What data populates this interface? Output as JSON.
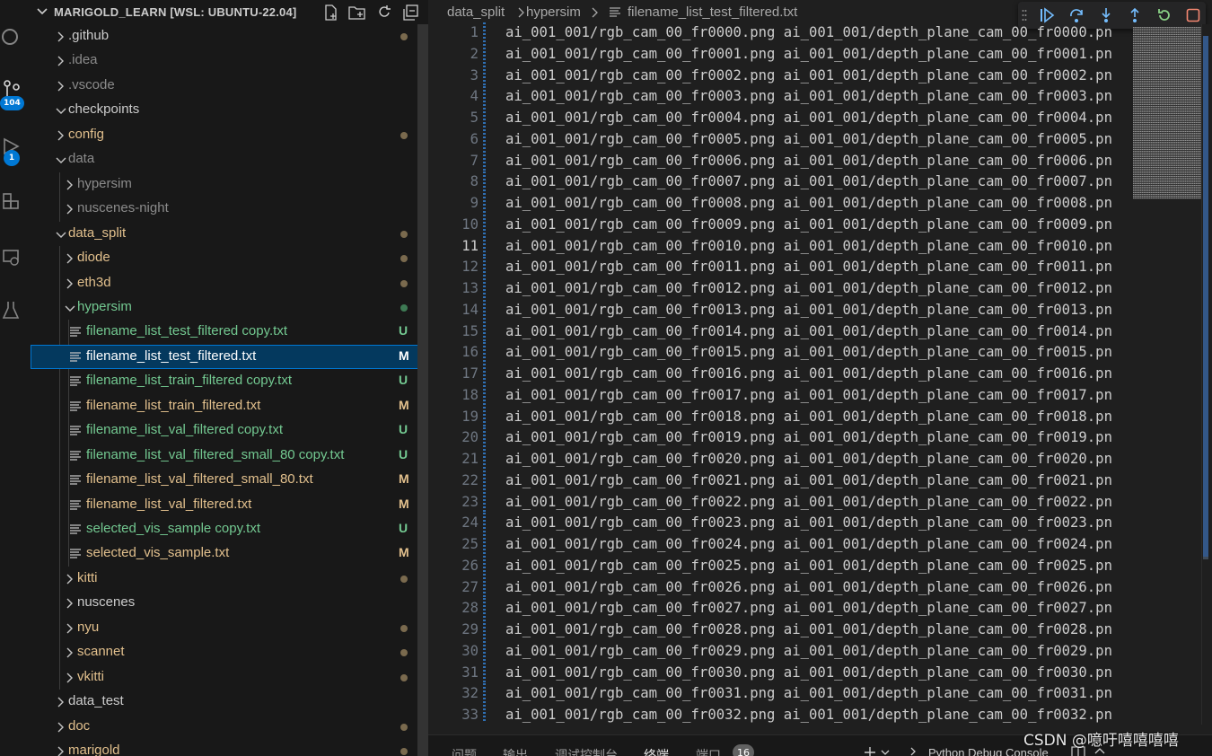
{
  "colors": {
    "folder_text": "#cccccc",
    "dim_text": "#8b8b8b",
    "modified": "#e2c08d",
    "untracked": "#73c991",
    "dot_modified": "#7a6a4e",
    "dot_green": "#3e7a54",
    "accent": "#0078d4"
  },
  "activity_bar": {
    "items": [
      {
        "icon": "search-icon"
      },
      {
        "icon": "source-control-icon",
        "badge": "104"
      },
      {
        "icon": "run-debug-icon",
        "badge": "1"
      },
      {
        "icon": "extensions-icon"
      },
      {
        "icon": "remote-explorer-icon"
      },
      {
        "icon": "testing-icon"
      }
    ]
  },
  "explorer": {
    "title": "MARIGOLD_LEARN [WSL: UBUNTU-22.04]",
    "actions": [
      "new-file-icon",
      "new-folder-icon",
      "refresh-icon",
      "collapse-all-icon"
    ],
    "tree": [
      {
        "label": ".github",
        "depth": 0,
        "type": "folder",
        "expanded": false,
        "color": "folder",
        "decoration": "dot-modified"
      },
      {
        "label": ".idea",
        "depth": 0,
        "type": "folder",
        "expanded": false,
        "color": "dim"
      },
      {
        "label": ".vscode",
        "depth": 0,
        "type": "folder",
        "expanded": false,
        "color": "dim"
      },
      {
        "label": "checkpoints",
        "depth": 0,
        "type": "folder",
        "expanded": true,
        "color": "folder"
      },
      {
        "label": "config",
        "depth": 0,
        "type": "folder",
        "expanded": false,
        "color": "modified",
        "decoration": "dot-modified"
      },
      {
        "label": "data",
        "depth": 0,
        "type": "folder",
        "expanded": true,
        "color": "dim"
      },
      {
        "label": "hypersim",
        "depth": 1,
        "type": "folder",
        "expanded": false,
        "color": "dim"
      },
      {
        "label": "nuscenes-night",
        "depth": 1,
        "type": "folder",
        "expanded": false,
        "color": "dim"
      },
      {
        "label": "data_split",
        "depth": 0,
        "type": "folder",
        "expanded": true,
        "color": "modified",
        "decoration": "dot-modified"
      },
      {
        "label": "diode",
        "depth": 1,
        "type": "folder",
        "expanded": false,
        "color": "modified",
        "decoration": "dot-modified"
      },
      {
        "label": "eth3d",
        "depth": 1,
        "type": "folder",
        "expanded": false,
        "color": "modified",
        "decoration": "dot-modified"
      },
      {
        "label": "hypersim",
        "depth": 1,
        "type": "folder",
        "expanded": true,
        "color": "untracked",
        "decoration": "dot-green"
      },
      {
        "label": "filename_list_test_filtered copy.txt",
        "depth": 2,
        "type": "file",
        "color": "untracked",
        "status": "U"
      },
      {
        "label": "filename_list_test_filtered.txt",
        "depth": 2,
        "type": "file",
        "color": "selected",
        "status": "M",
        "selected": true
      },
      {
        "label": "filename_list_train_filtered copy.txt",
        "depth": 2,
        "type": "file",
        "color": "untracked",
        "status": "U"
      },
      {
        "label": "filename_list_train_filtered.txt",
        "depth": 2,
        "type": "file",
        "color": "modified",
        "status": "M"
      },
      {
        "label": "filename_list_val_filtered copy.txt",
        "depth": 2,
        "type": "file",
        "color": "untracked",
        "status": "U"
      },
      {
        "label": "filename_list_val_filtered_small_80 copy.txt",
        "depth": 2,
        "type": "file",
        "color": "untracked",
        "status": "U"
      },
      {
        "label": "filename_list_val_filtered_small_80.txt",
        "depth": 2,
        "type": "file",
        "color": "modified",
        "status": "M"
      },
      {
        "label": "filename_list_val_filtered.txt",
        "depth": 2,
        "type": "file",
        "color": "modified",
        "status": "M"
      },
      {
        "label": "selected_vis_sample copy.txt",
        "depth": 2,
        "type": "file",
        "color": "untracked",
        "status": "U"
      },
      {
        "label": "selected_vis_sample.txt",
        "depth": 2,
        "type": "file",
        "color": "modified",
        "status": "M"
      },
      {
        "label": "kitti",
        "depth": 1,
        "type": "folder",
        "expanded": false,
        "color": "modified",
        "decoration": "dot-modified"
      },
      {
        "label": "nuscenes",
        "depth": 1,
        "type": "folder",
        "expanded": false,
        "color": "folder"
      },
      {
        "label": "nyu",
        "depth": 1,
        "type": "folder",
        "expanded": false,
        "color": "modified",
        "decoration": "dot-modified"
      },
      {
        "label": "scannet",
        "depth": 1,
        "type": "folder",
        "expanded": false,
        "color": "modified",
        "decoration": "dot-modified"
      },
      {
        "label": "vkitti",
        "depth": 1,
        "type": "folder",
        "expanded": false,
        "color": "modified",
        "decoration": "dot-modified"
      },
      {
        "label": "data_test",
        "depth": 0,
        "type": "folder",
        "expanded": false,
        "color": "folder"
      },
      {
        "label": "doc",
        "depth": 0,
        "type": "folder",
        "expanded": false,
        "color": "modified",
        "decoration": "dot-modified"
      },
      {
        "label": "marigold",
        "depth": 0,
        "type": "folder",
        "expanded": false,
        "color": "modified",
        "decoration": "dot-modified"
      }
    ]
  },
  "breadcrumb": {
    "parts": [
      "data_split",
      "hypersim",
      "filename_list_test_filtered.txt"
    ],
    "file_icon": "text-file-icon"
  },
  "debug_toolbar": {
    "buttons": [
      "drag-handle-icon",
      "continue-icon",
      "step-over-icon",
      "step-into-icon",
      "step-out-icon",
      "restart-icon",
      "stop-icon"
    ]
  },
  "editor": {
    "active_line": 11,
    "lines": [
      {
        "n": "1",
        "text": "ai_001_001/rgb_cam_00_fr0000.png ai_001_001/depth_plane_cam_00_fr0000.pn"
      },
      {
        "n": "2",
        "text": "ai_001_001/rgb_cam_00_fr0001.png ai_001_001/depth_plane_cam_00_fr0001.pn"
      },
      {
        "n": "3",
        "text": "ai_001_001/rgb_cam_00_fr0002.png ai_001_001/depth_plane_cam_00_fr0002.pn"
      },
      {
        "n": "4",
        "text": "ai_001_001/rgb_cam_00_fr0003.png ai_001_001/depth_plane_cam_00_fr0003.pn"
      },
      {
        "n": "5",
        "text": "ai_001_001/rgb_cam_00_fr0004.png ai_001_001/depth_plane_cam_00_fr0004.pn"
      },
      {
        "n": "6",
        "text": "ai_001_001/rgb_cam_00_fr0005.png ai_001_001/depth_plane_cam_00_fr0005.pn"
      },
      {
        "n": "7",
        "text": "ai_001_001/rgb_cam_00_fr0006.png ai_001_001/depth_plane_cam_00_fr0006.pn"
      },
      {
        "n": "8",
        "text": "ai_001_001/rgb_cam_00_fr0007.png ai_001_001/depth_plane_cam_00_fr0007.pn"
      },
      {
        "n": "9",
        "text": "ai_001_001/rgb_cam_00_fr0008.png ai_001_001/depth_plane_cam_00_fr0008.pn"
      },
      {
        "n": "10",
        "text": "ai_001_001/rgb_cam_00_fr0009.png ai_001_001/depth_plane_cam_00_fr0009.pn"
      },
      {
        "n": "11",
        "text": "ai_001_001/rgb_cam_00_fr0010.png ai_001_001/depth_plane_cam_00_fr0010.pn"
      },
      {
        "n": "12",
        "text": "ai_001_001/rgb_cam_00_fr0011.png ai_001_001/depth_plane_cam_00_fr0011.pn"
      },
      {
        "n": "13",
        "text": "ai_001_001/rgb_cam_00_fr0012.png ai_001_001/depth_plane_cam_00_fr0012.pn"
      },
      {
        "n": "14",
        "text": "ai_001_001/rgb_cam_00_fr0013.png ai_001_001/depth_plane_cam_00_fr0013.pn"
      },
      {
        "n": "15",
        "text": "ai_001_001/rgb_cam_00_fr0014.png ai_001_001/depth_plane_cam_00_fr0014.pn"
      },
      {
        "n": "16",
        "text": "ai_001_001/rgb_cam_00_fr0015.png ai_001_001/depth_plane_cam_00_fr0015.pn"
      },
      {
        "n": "17",
        "text": "ai_001_001/rgb_cam_00_fr0016.png ai_001_001/depth_plane_cam_00_fr0016.pn"
      },
      {
        "n": "18",
        "text": "ai_001_001/rgb_cam_00_fr0017.png ai_001_001/depth_plane_cam_00_fr0017.pn"
      },
      {
        "n": "19",
        "text": "ai_001_001/rgb_cam_00_fr0018.png ai_001_001/depth_plane_cam_00_fr0018.pn"
      },
      {
        "n": "20",
        "text": "ai_001_001/rgb_cam_00_fr0019.png ai_001_001/depth_plane_cam_00_fr0019.pn"
      },
      {
        "n": "21",
        "text": "ai_001_001/rgb_cam_00_fr0020.png ai_001_001/depth_plane_cam_00_fr0020.pn"
      },
      {
        "n": "22",
        "text": "ai_001_001/rgb_cam_00_fr0021.png ai_001_001/depth_plane_cam_00_fr0021.pn"
      },
      {
        "n": "23",
        "text": "ai_001_001/rgb_cam_00_fr0022.png ai_001_001/depth_plane_cam_00_fr0022.pn"
      },
      {
        "n": "24",
        "text": "ai_001_001/rgb_cam_00_fr0023.png ai_001_001/depth_plane_cam_00_fr0023.pn"
      },
      {
        "n": "25",
        "text": "ai_001_001/rgb_cam_00_fr0024.png ai_001_001/depth_plane_cam_00_fr0024.pn"
      },
      {
        "n": "26",
        "text": "ai_001_001/rgb_cam_00_fr0025.png ai_001_001/depth_plane_cam_00_fr0025.pn"
      },
      {
        "n": "27",
        "text": "ai_001_001/rgb_cam_00_fr0026.png ai_001_001/depth_plane_cam_00_fr0026.pn"
      },
      {
        "n": "28",
        "text": "ai_001_001/rgb_cam_00_fr0027.png ai_001_001/depth_plane_cam_00_fr0027.pn"
      },
      {
        "n": "29",
        "text": "ai_001_001/rgb_cam_00_fr0028.png ai_001_001/depth_plane_cam_00_fr0028.pn"
      },
      {
        "n": "30",
        "text": "ai_001_001/rgb_cam_00_fr0029.png ai_001_001/depth_plane_cam_00_fr0029.pn"
      },
      {
        "n": "31",
        "text": "ai_001_001/rgb_cam_00_fr0030.png ai_001_001/depth_plane_cam_00_fr0030.pn"
      },
      {
        "n": "32",
        "text": "ai_001_001/rgb_cam_00_fr0031.png ai_001_001/depth_plane_cam_00_fr0031.pn"
      },
      {
        "n": "33",
        "text": "ai_001_001/rgb_cam_00_fr0032.png ai_001_001/depth_plane_cam_00_fr0032.pn"
      }
    ]
  },
  "panel": {
    "tabs": [
      {
        "label": "问题"
      },
      {
        "label": "输出"
      },
      {
        "label": "调试控制台"
      },
      {
        "label": "终端",
        "active": true
      },
      {
        "label": "端口",
        "badge": "16"
      }
    ],
    "actions": [
      "add-icon",
      "chevron-down-icon"
    ],
    "terminal_name": "Python Debug Console"
  },
  "watermark": "CSDN @噫吁嘻嘻嘻嘻"
}
